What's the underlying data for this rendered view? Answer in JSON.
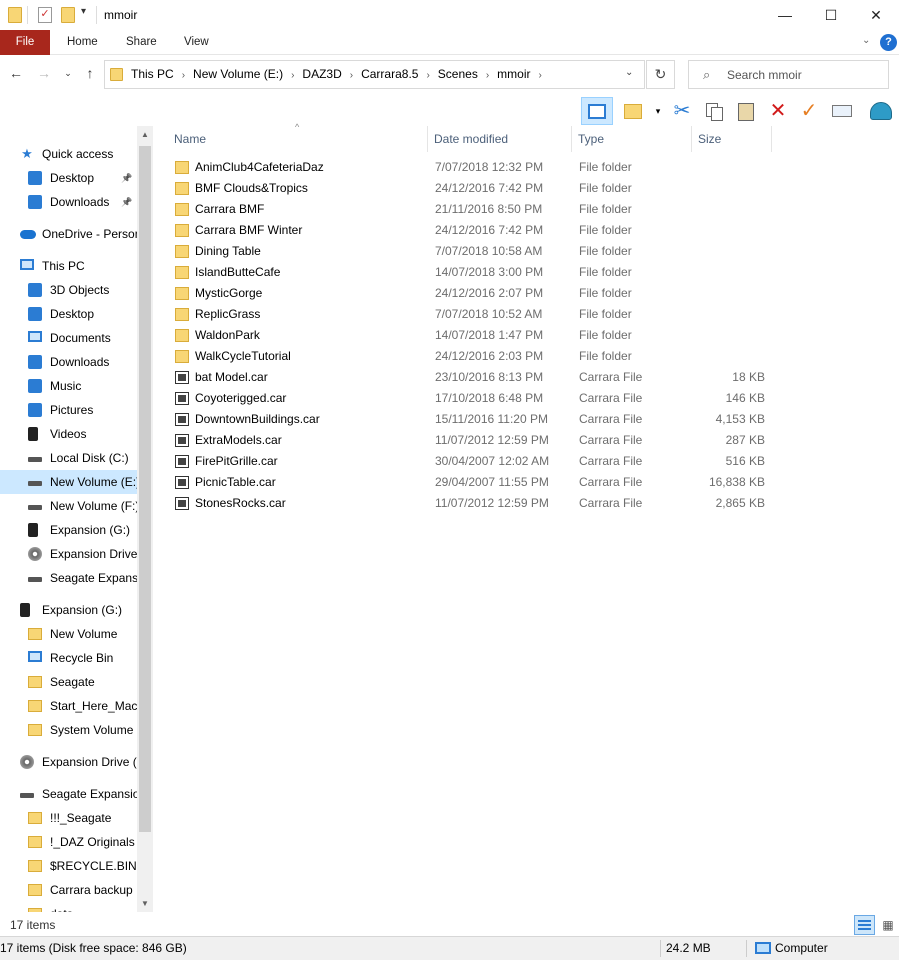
{
  "window": {
    "title": "mmoir",
    "minimize": "—",
    "maximize": "☐",
    "close": "✕"
  },
  "ribbon": {
    "tabs": [
      "File",
      "Home",
      "Share",
      "View"
    ],
    "help": "?"
  },
  "address": {
    "crumbs": [
      "This PC",
      "New Volume (E:)",
      "DAZ3D",
      "Carrara8.5",
      "Scenes",
      "mmoir"
    ]
  },
  "search": {
    "placeholder": "Search mmoir"
  },
  "nav_pane": {
    "items": [
      {
        "label": "Quick access",
        "icon": "star-icon"
      },
      {
        "label": "Desktop",
        "icon": "desktop-icon",
        "pinned": true
      },
      {
        "label": "Downloads",
        "icon": "download-icon",
        "pinned": true
      },
      {
        "label": "OneDrive - Person",
        "icon": "cloud-icon"
      },
      {
        "label": "This PC",
        "icon": "computer-icon"
      },
      {
        "label": "3D Objects",
        "icon": "cube-icon"
      },
      {
        "label": "Desktop",
        "icon": "desktop-icon"
      },
      {
        "label": "Documents",
        "icon": "document-icon"
      },
      {
        "label": "Downloads",
        "icon": "download-icon"
      },
      {
        "label": "Music",
        "icon": "music-icon"
      },
      {
        "label": "Pictures",
        "icon": "picture-icon"
      },
      {
        "label": "Videos",
        "icon": "video-icon"
      },
      {
        "label": "Local Disk (C:)",
        "icon": "drive-icon"
      },
      {
        "label": "New Volume (E:)",
        "icon": "drive-icon",
        "selected": true
      },
      {
        "label": "New Volume (F:)",
        "icon": "drive-icon"
      },
      {
        "label": "Expansion (G:)",
        "icon": "usb-drive-icon"
      },
      {
        "label": "Expansion Drive",
        "icon": "disc-icon"
      },
      {
        "label": "Seagate Expansio",
        "icon": "drive-icon"
      },
      {
        "label": "Expansion (G:)",
        "icon": "usb-drive-icon"
      },
      {
        "label": "New Volume",
        "icon": "folder-icon"
      },
      {
        "label": "Recycle Bin",
        "icon": "recycle-bin-icon"
      },
      {
        "label": "Seagate",
        "icon": "folder-icon"
      },
      {
        "label": "Start_Here_Mac.",
        "icon": "folder-icon"
      },
      {
        "label": "System Volume I",
        "icon": "folder-icon"
      },
      {
        "label": "Expansion Drive (I",
        "icon": "disc-icon"
      },
      {
        "label": "Seagate Expansion",
        "icon": "drive-icon"
      },
      {
        "label": "!!!_Seagate",
        "icon": "folder-icon"
      },
      {
        "label": "!_DAZ Originals",
        "icon": "folder-icon"
      },
      {
        "label": "$RECYCLE.BIN",
        "icon": "folder-icon"
      },
      {
        "label": "Carrara backup",
        "icon": "folder-icon"
      },
      {
        "label": "data",
        "icon": "folder-icon"
      }
    ]
  },
  "columns": [
    "Name",
    "Date modified",
    "Type",
    "Size"
  ],
  "files": [
    {
      "name": "AnimClub4CafeteriaDaz",
      "date": "7/07/2018 12:32 PM",
      "type": "File folder",
      "size": "",
      "kind": "folder"
    },
    {
      "name": "BMF Clouds&Tropics",
      "date": "24/12/2016 7:42 PM",
      "type": "File folder",
      "size": "",
      "kind": "folder"
    },
    {
      "name": "Carrara BMF",
      "date": "21/11/2016 8:50 PM",
      "type": "File folder",
      "size": "",
      "kind": "folder"
    },
    {
      "name": "Carrara BMF Winter",
      "date": "24/12/2016 7:42 PM",
      "type": "File folder",
      "size": "",
      "kind": "folder"
    },
    {
      "name": "Dining Table",
      "date": "7/07/2018 10:58 AM",
      "type": "File folder",
      "size": "",
      "kind": "folder"
    },
    {
      "name": "IslandButteCafe",
      "date": "14/07/2018 3:00 PM",
      "type": "File folder",
      "size": "",
      "kind": "folder"
    },
    {
      "name": "MysticGorge",
      "date": "24/12/2016 2:07 PM",
      "type": "File folder",
      "size": "",
      "kind": "folder"
    },
    {
      "name": "ReplicGrass",
      "date": "7/07/2018 10:52 AM",
      "type": "File folder",
      "size": "",
      "kind": "folder"
    },
    {
      "name": "WaldonPark",
      "date": "14/07/2018 1:47 PM",
      "type": "File folder",
      "size": "",
      "kind": "folder"
    },
    {
      "name": "WalkCycleTutorial",
      "date": "24/12/2016 2:03 PM",
      "type": "File folder",
      "size": "",
      "kind": "folder"
    },
    {
      "name": "bat Model.car",
      "date": "23/10/2016 8:13 PM",
      "type": "Carrara File",
      "size": "18 KB",
      "kind": "car"
    },
    {
      "name": "Coyoterigged.car",
      "date": "17/10/2018 6:48 PM",
      "type": "Carrara File",
      "size": "146 KB",
      "kind": "car"
    },
    {
      "name": "DowntownBuildings.car",
      "date": "15/11/2016 11:20 PM",
      "type": "Carrara File",
      "size": "4,153 KB",
      "kind": "car"
    },
    {
      "name": "ExtraModels.car",
      "date": "11/07/2012 12:59 PM",
      "type": "Carrara File",
      "size": "287 KB",
      "kind": "car"
    },
    {
      "name": "FirePitGrille.car",
      "date": "30/04/2007 12:02 AM",
      "type": "Carrara File",
      "size": "516 KB",
      "kind": "car"
    },
    {
      "name": "PicnicTable.car",
      "date": "29/04/2007 11:55 PM",
      "type": "Carrara File",
      "size": "16,838 KB",
      "kind": "car"
    },
    {
      "name": "StonesRocks.car",
      "date": "11/07/2012 12:59 PM",
      "type": "Carrara File",
      "size": "2,865 KB",
      "kind": "car"
    }
  ],
  "status": {
    "item_count": "17 items",
    "free_space": "17 items (Disk free space: 846 GB)",
    "selection_size": "24.2 MB",
    "location": "Computer"
  },
  "colors": {
    "file_tab": "#a8271c",
    "selection": "#cce8ff",
    "folder": "#f8d675",
    "accent": "#2b7cd3"
  }
}
